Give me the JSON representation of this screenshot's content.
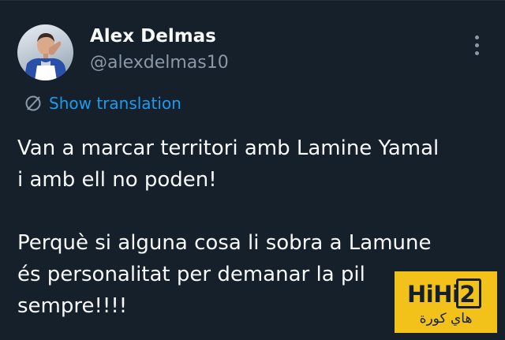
{
  "author": {
    "display_name": "Alex Delmas",
    "handle": "@alexdelmas10",
    "avatar_icon": "profile-photo"
  },
  "more_icon": "more-vertical-icon",
  "translate": {
    "label": "Show translation",
    "icon": "globe-icon",
    "color": "#1d9bf0"
  },
  "tweet": {
    "lines": [
      "Van a marcar territori amb Lamine Yamal",
      "i amb ell no poden!",
      "",
      "Perquè si alguna cosa li sobra a Lamune",
      "és personalitat per demanar la pil",
      "sempre!!!!"
    ]
  },
  "watermark": {
    "brand": "HiHi2",
    "subtitle": "هاي كورة",
    "color": "#f2c21a"
  },
  "colors": {
    "background": "#15202b",
    "text": "#f7f9f9",
    "secondary_text": "#8b98a5"
  }
}
